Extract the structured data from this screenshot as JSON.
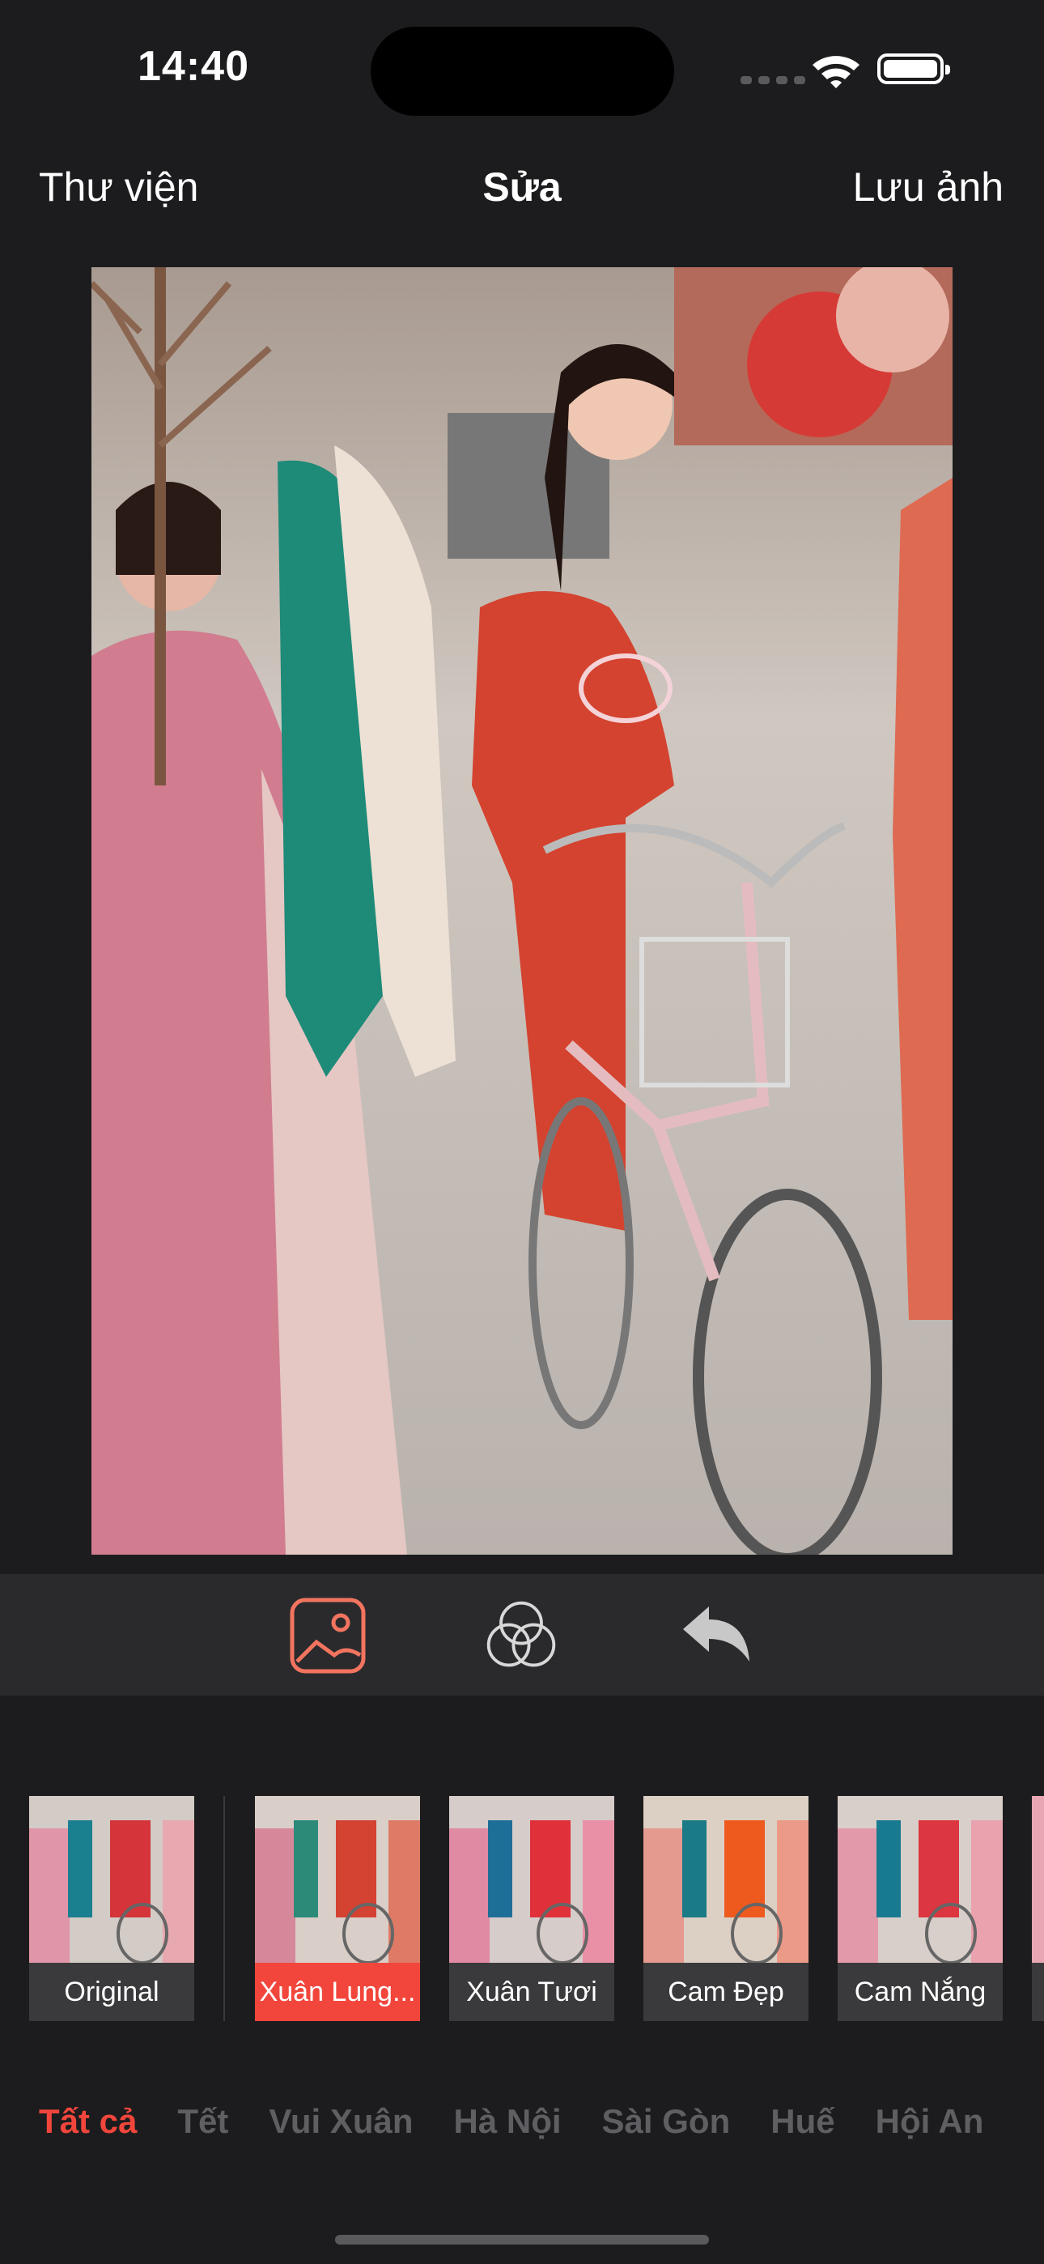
{
  "status_bar": {
    "time": "14:40"
  },
  "nav": {
    "left": "Thư viện",
    "title": "Sửa",
    "right": "Lưu ảnh"
  },
  "photo": {
    "icon": "photo-image"
  },
  "toolbar": {
    "tools": [
      "photo-frame-icon",
      "filters-circles-icon",
      "undo-arrow-icon"
    ],
    "accent": "#f2463c"
  },
  "filters": {
    "items": [
      {
        "label": "Original"
      },
      {
        "label": "Xuân Lung..."
      },
      {
        "label": "Xuân Tươi"
      },
      {
        "label": "Cam Đẹp"
      },
      {
        "label": "Cam Nắng"
      }
    ],
    "selected": "Xuân Lung..."
  },
  "categories": {
    "items": [
      "Tất cả",
      "Tết",
      "Vui Xuân",
      "Hà Nội",
      "Sài Gòn",
      "Huế",
      "Hội An"
    ],
    "active": "Tất cả"
  }
}
